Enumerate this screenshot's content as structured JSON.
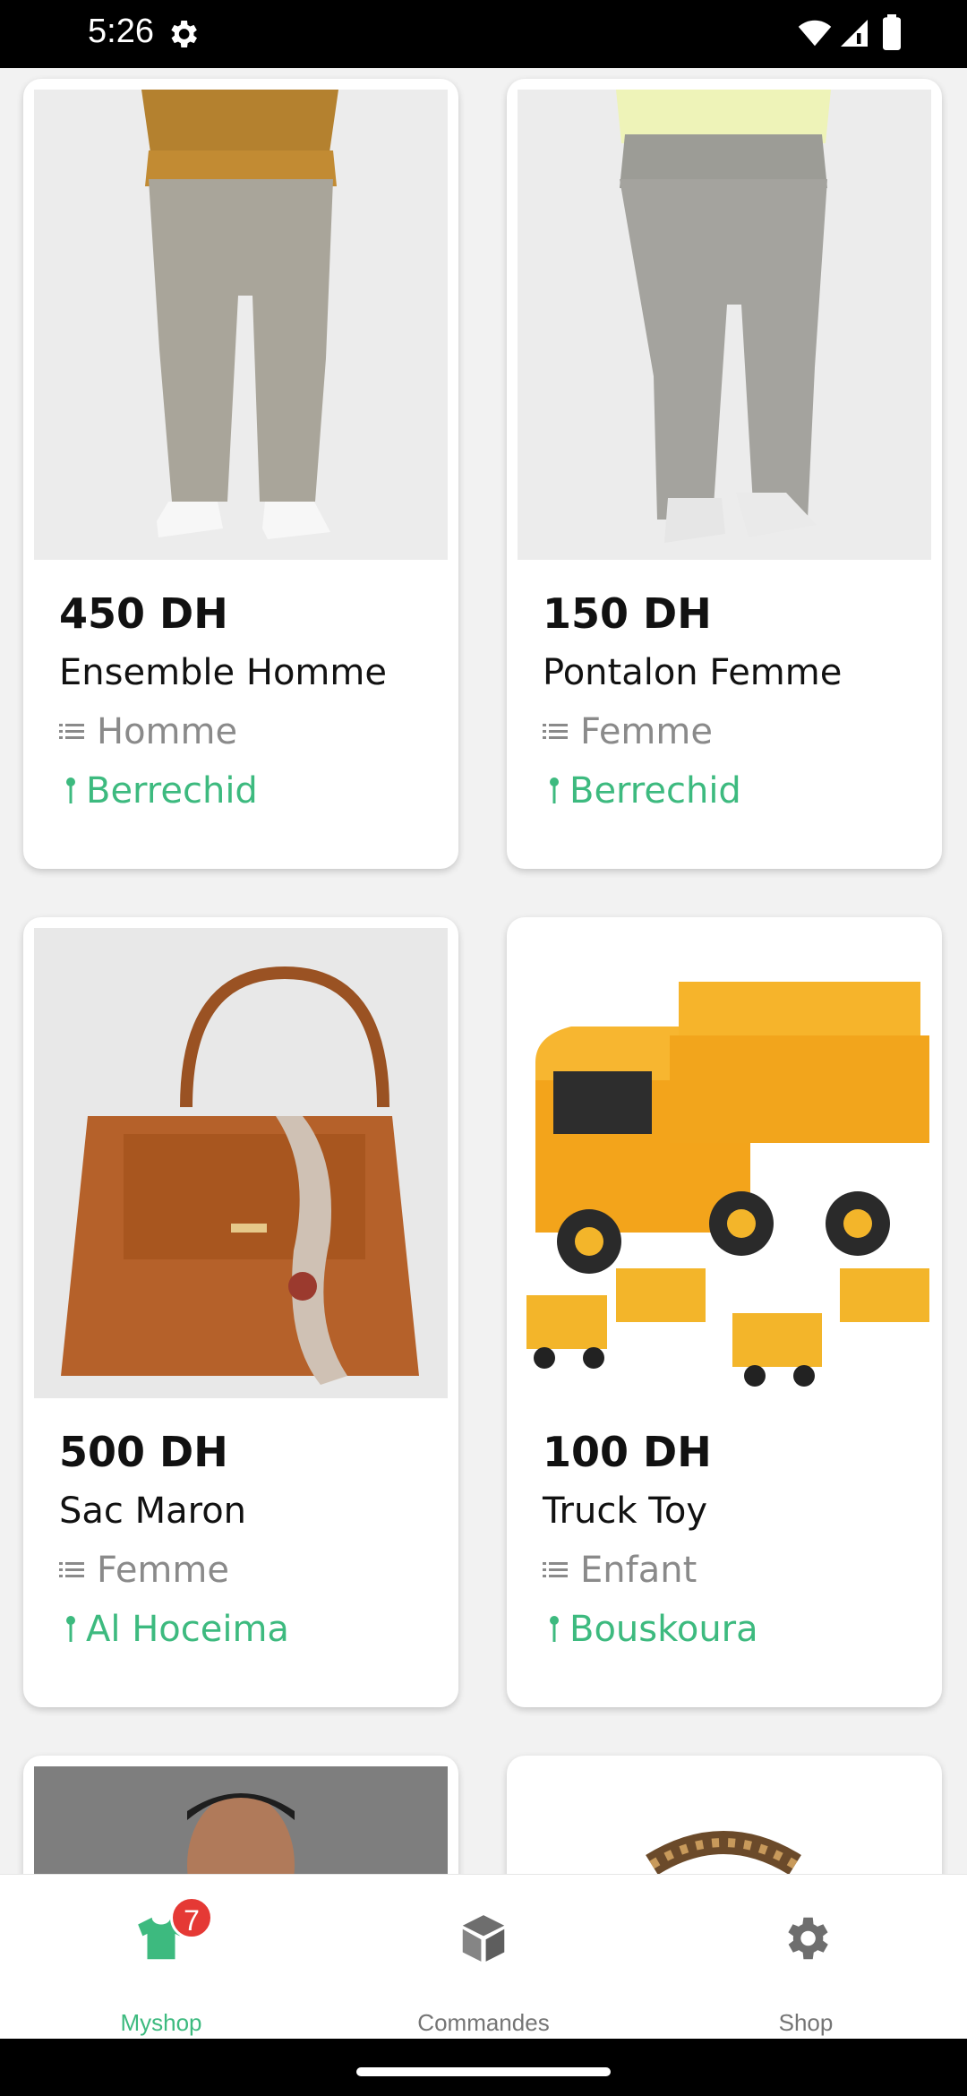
{
  "status_bar": {
    "time": "5:26",
    "icons": [
      "gear-icon",
      "wifi-icon",
      "signal-icon",
      "battery-icon"
    ]
  },
  "products": [
    {
      "price": "450 DH",
      "name": "Ensemble Homme",
      "category": "Homme",
      "location": "Berrechid"
    },
    {
      "price": "150 DH",
      "name": "Pontalon Femme",
      "category": "Femme",
      "location": "Berrechid"
    },
    {
      "price": "500 DH",
      "name": "Sac Maron",
      "category": "Femme",
      "location": "Al Hoceima"
    },
    {
      "price": "100 DH",
      "name": "Truck Toy",
      "category": "Enfant",
      "location": "Bouskoura"
    }
  ],
  "bottom_nav": {
    "items": [
      {
        "label": "Myshop",
        "icon": "tshirt-icon",
        "active": true,
        "badge": "7"
      },
      {
        "label": "Commandes",
        "icon": "box-icon",
        "active": false
      },
      {
        "label": "Shop",
        "icon": "gear-icon",
        "active": false
      }
    ]
  },
  "colors": {
    "accent": "#3dba7f",
    "badge": "#e53935",
    "text_muted": "#8a8a8a"
  }
}
